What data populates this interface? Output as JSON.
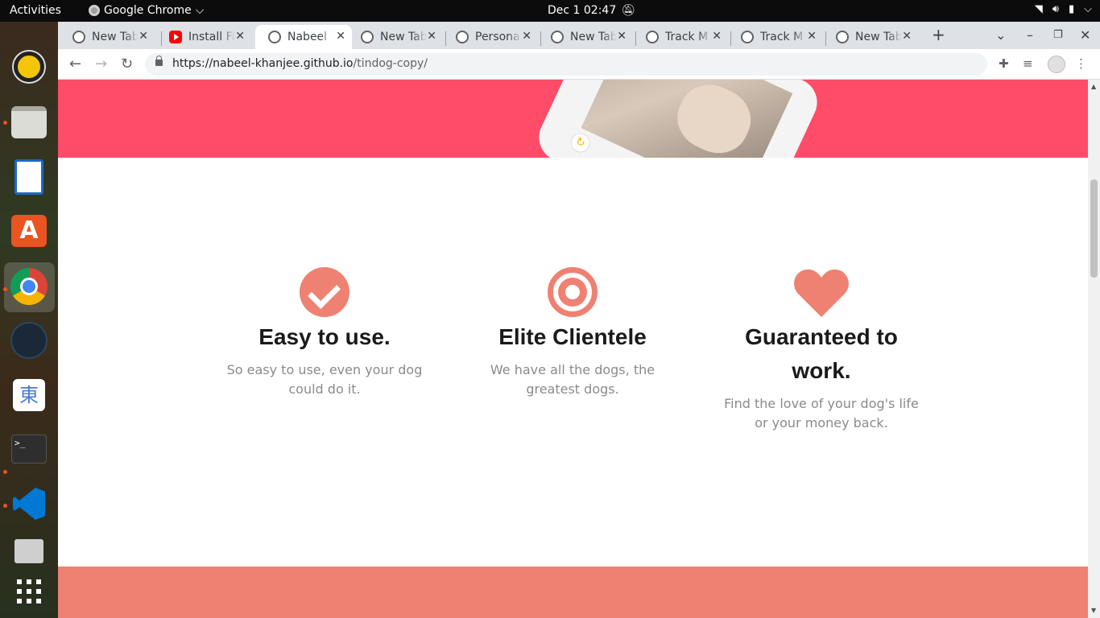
{
  "topbar": {
    "activities": "Activities",
    "app_name": "Google Chrome",
    "clock": "Dec 1  02:47"
  },
  "tabs": [
    {
      "title": "New Tab",
      "favicon": "chrome-icon"
    },
    {
      "title": "Install Fi",
      "favicon": "youtube-icon"
    },
    {
      "title": "Nabeel",
      "favicon": "globe-icon",
      "active": true
    },
    {
      "title": "New Tab",
      "favicon": "chrome-icon"
    },
    {
      "title": "Persona",
      "favicon": "globe-icon"
    },
    {
      "title": "New Tab",
      "favicon": "chrome-icon"
    },
    {
      "title": "Track M",
      "favicon": "globe-icon"
    },
    {
      "title": "Track M",
      "favicon": "globe-icon"
    },
    {
      "title": "New Tab",
      "favicon": "chrome-icon"
    }
  ],
  "omnibox": {
    "host": "https://nabeel-khanjee.github.io",
    "path": "/tindog-copy/"
  },
  "features": [
    {
      "icon": "check-circle-icon",
      "title": "Easy to use.",
      "text": "So easy to use, even your dog could do it."
    },
    {
      "icon": "bullseye-icon",
      "title": "Elite Clientele",
      "text": "We have all the dogs, the greatest dogs."
    },
    {
      "icon": "heart-icon",
      "title": "Guaranteed to work.",
      "text": "Find the love of your dog's life or your money back."
    }
  ],
  "colors": {
    "hero": "#ff4c68",
    "accent": "#ef8172",
    "heading": "#1a1a1a",
    "body_text": "#8a8a8a"
  }
}
